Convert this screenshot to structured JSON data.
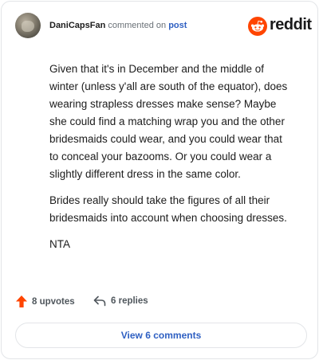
{
  "header": {
    "username": "DaniCapsFan",
    "action_text": "commented on",
    "post_link": "post",
    "brand": "reddit"
  },
  "comment": {
    "paragraphs": [
      "Given that it's in December and the middle of winter (unless y'all are south of the equator), does wearing strapless dresses make sense? Maybe she could find a matching wrap you and the other bridesmaids could wear, and you could wear that to conceal your bazooms. Or you could wear a slightly different dress in the same color.",
      "Brides really should take the figures of all their bridesmaids into account when choosing dresses.",
      "NTA"
    ]
  },
  "footer": {
    "upvotes_label": "8 upvotes",
    "replies_label": "6 replies",
    "view_comments_label": "View 6 comments"
  },
  "colors": {
    "reddit_orange": "#ff4500",
    "link_blue": "#2e5fc2",
    "border": "#e3e5e8"
  },
  "icons": {
    "upvote": "upvote-arrow-icon",
    "reply": "reply-arrow-icon",
    "logo": "reddit-snoo-icon"
  }
}
